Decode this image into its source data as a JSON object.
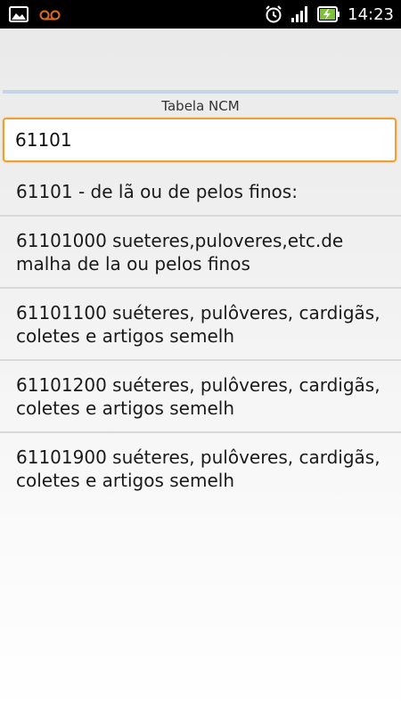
{
  "status_bar": {
    "time": "14:23",
    "icons": [
      "gallery-icon",
      "voicemail-icon",
      "alarm-icon",
      "signal-icon",
      "battery-charging-icon"
    ],
    "accent_voicemail": "#e06a1a",
    "battery_color": "#7ec23a"
  },
  "screen": {
    "title": "Tabela NCM"
  },
  "search": {
    "value": "61101",
    "focus_color": "#f0a030"
  },
  "results": [
    {
      "text": "61101 - de lã ou de pelos finos:"
    },
    {
      "text": "61101000 sueteres,puloveres,etc.de malha de la ou pelos finos"
    },
    {
      "text": "61101100 suéteres, pulôveres, cardigãs, coletes e artigos semelh"
    },
    {
      "text": "61101200 suéteres, pulôveres, cardigãs, coletes e artigos semelh"
    },
    {
      "text": "61101900 suéteres, pulôveres, cardigãs, coletes e artigos semelh"
    }
  ]
}
